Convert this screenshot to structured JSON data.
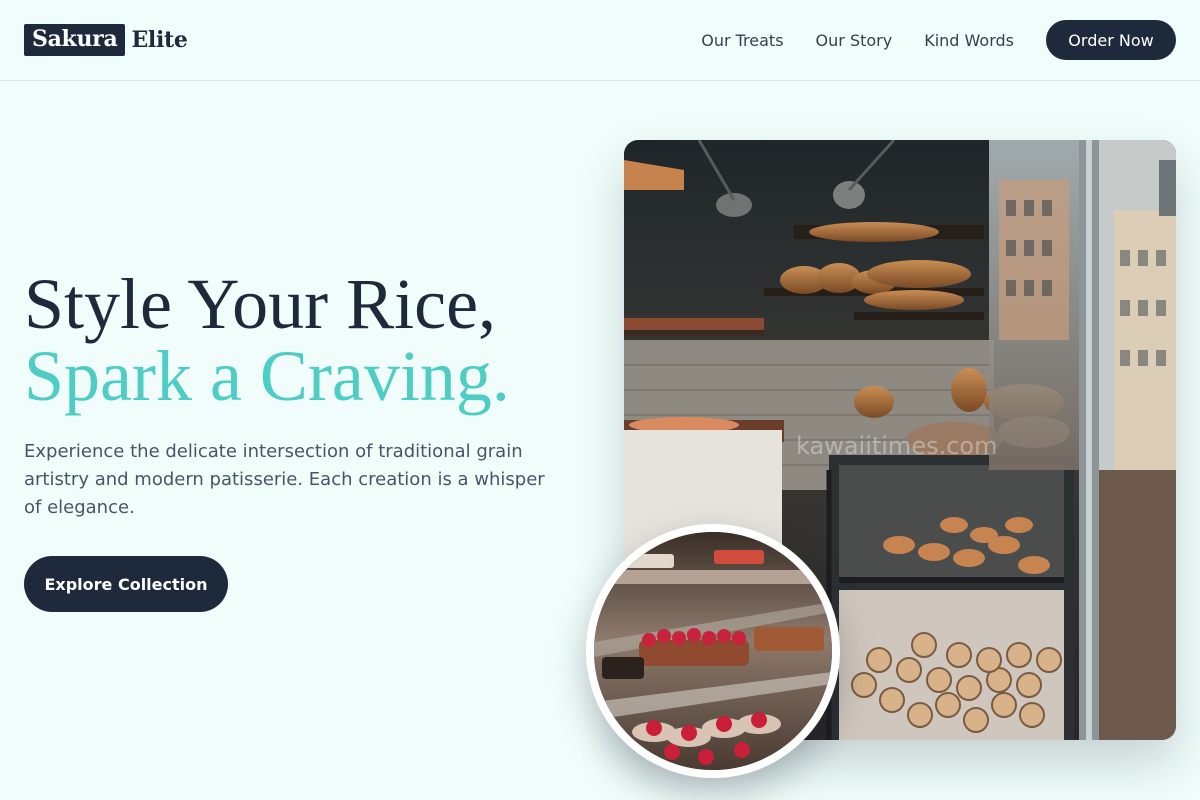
{
  "brand": {
    "highlight": "Sakura",
    "rest": "Elite"
  },
  "nav": {
    "links": [
      {
        "label": "Our Treats"
      },
      {
        "label": "Our Story"
      },
      {
        "label": "Kind Words"
      }
    ],
    "cta_label": "Order Now"
  },
  "hero": {
    "headline_line1": "Style Your Rice,",
    "headline_line2": "Spark a Craving.",
    "description": "Experience the delicate intersection of traditional grain artistry and modern patisserie. Each creation is a whisper of elegance.",
    "cta_label": "Explore Collection"
  },
  "images": {
    "main": {
      "subject": "bakery interior with bread shelves and pastry display case",
      "watermark": "kawaiitimes.com"
    },
    "circle": {
      "subject": "glass dessert case with berry tarts"
    }
  },
  "colors": {
    "dark": "#1e293b",
    "accent": "#4ecdc4",
    "background": "#f0fdfa"
  }
}
